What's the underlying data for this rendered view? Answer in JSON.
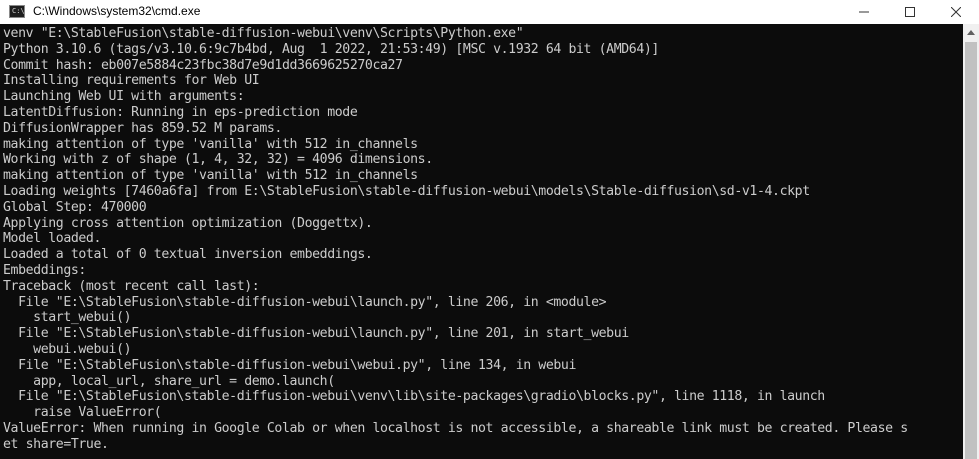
{
  "window": {
    "title": "C:\\Windows\\system32\\cmd.exe",
    "icon_prompt": "C:\\",
    "controls": {
      "minimize": "minimize-icon",
      "maximize": "maximize-icon",
      "close": "close-icon"
    }
  },
  "console": {
    "lines": [
      "venv \"E:\\StableFusion\\stable-diffusion-webui\\venv\\Scripts\\Python.exe\"",
      "Python 3.10.6 (tags/v3.10.6:9c7b4bd, Aug  1 2022, 21:53:49) [MSC v.1932 64 bit (AMD64)]",
      "Commit hash: eb007e5884c23fbc38d7e9d1dd3669625270ca27",
      "Installing requirements for Web UI",
      "Launching Web UI with arguments:",
      "LatentDiffusion: Running in eps-prediction mode",
      "DiffusionWrapper has 859.52 M params.",
      "making attention of type 'vanilla' with 512 in_channels",
      "Working with z of shape (1, 4, 32, 32) = 4096 dimensions.",
      "making attention of type 'vanilla' with 512 in_channels",
      "Loading weights [7460a6fa] from E:\\StableFusion\\stable-diffusion-webui\\models\\Stable-diffusion\\sd-v1-4.ckpt",
      "Global Step: 470000",
      "Applying cross attention optimization (Doggettx).",
      "Model loaded.",
      "Loaded a total of 0 textual inversion embeddings.",
      "Embeddings:",
      "Traceback (most recent call last):",
      "  File \"E:\\StableFusion\\stable-diffusion-webui\\launch.py\", line 206, in <module>",
      "    start_webui()",
      "  File \"E:\\StableFusion\\stable-diffusion-webui\\launch.py\", line 201, in start_webui",
      "    webui.webui()",
      "  File \"E:\\StableFusion\\stable-diffusion-webui\\webui.py\", line 134, in webui",
      "    app, local_url, share_url = demo.launch(",
      "  File \"E:\\StableFusion\\stable-diffusion-webui\\venv\\lib\\site-packages\\gradio\\blocks.py\", line 1118, in launch",
      "    raise ValueError(",
      "ValueError: When running in Google Colab or when localhost is not accessible, a shareable link must be created. Please s",
      "et share=True."
    ]
  },
  "colors": {
    "console_bg": "#0c0c0c",
    "console_text": "#cccccc",
    "titlebar_bg": "#ffffff",
    "scrollbar_track": "#f0f0f0",
    "scrollbar_thumb": "#c1c1c1"
  }
}
